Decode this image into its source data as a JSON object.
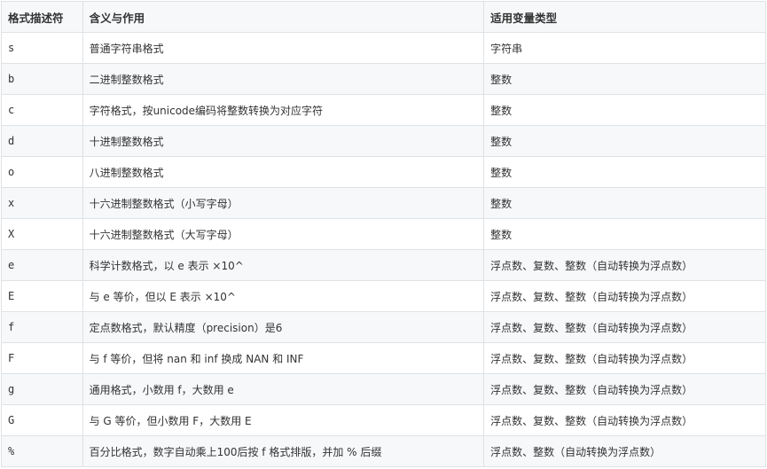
{
  "table": {
    "headers": [
      "格式描述符",
      "含义与作用",
      "适用变量类型"
    ],
    "rows": [
      [
        "s",
        "普通字符串格式",
        "字符串"
      ],
      [
        "b",
        "二进制整数格式",
        "整数"
      ],
      [
        "c",
        "字符格式，按unicode编码将整数转换为对应字符",
        "整数"
      ],
      [
        "d",
        "十进制整数格式",
        "整数"
      ],
      [
        "o",
        "八进制整数格式",
        "整数"
      ],
      [
        "x",
        "十六进制整数格式（小写字母）",
        "整数"
      ],
      [
        "X",
        "十六进制整数格式（大写字母）",
        "整数"
      ],
      [
        "e",
        "科学计数格式，以 e 表示 ×10^",
        "浮点数、复数、整数（自动转换为浮点数）"
      ],
      [
        "E",
        "与 e 等价，但以 E 表示 ×10^",
        "浮点数、复数、整数（自动转换为浮点数）"
      ],
      [
        "f",
        "定点数格式，默认精度（precision）是6",
        "浮点数、复数、整数（自动转换为浮点数）"
      ],
      [
        "F",
        "与 f 等价，但将 nan 和 inf 换成 NAN 和 INF",
        "浮点数、复数、整数（自动转换为浮点数）"
      ],
      [
        "g",
        "通用格式，小数用 f，大数用 e",
        "浮点数、复数、整数（自动转换为浮点数）"
      ],
      [
        "G",
        "与 G 等价，但小数用 F，大数用 E",
        "浮点数、复数、整数（自动转换为浮点数）"
      ],
      [
        "%",
        "百分比格式，数字自动乘上100后按 f 格式排版，并加 % 后缀",
        "浮点数、整数（自动转换为浮点数）"
      ]
    ]
  }
}
